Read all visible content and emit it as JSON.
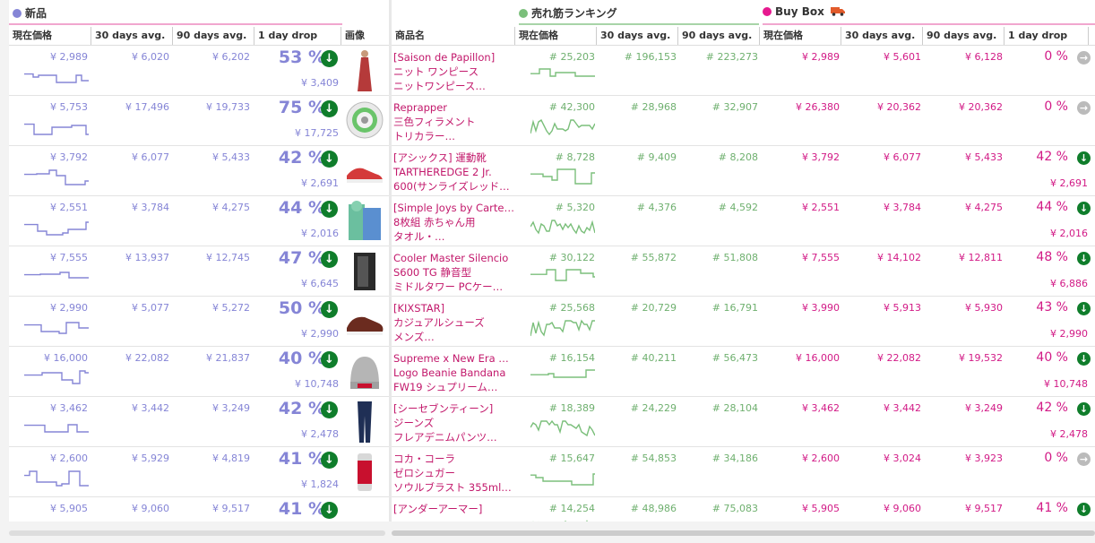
{
  "left": {
    "group_label": "新品",
    "headers": [
      "現在価格",
      "30 days avg.",
      "90 days avg.",
      "1 day drop",
      "画像"
    ]
  },
  "right": {
    "headers": [
      "商品名",
      "現在価格",
      "30 days avg.",
      "90 days avg.",
      "現在価格",
      "30 days avg.",
      "90 days avg.",
      "1 day drop"
    ],
    "group_sales": "売れ筋ランキング",
    "group_buybox": "Buy Box",
    "truck_icon": "truck-icon"
  },
  "colors": {
    "new": "#8585d6",
    "sales": "#7bbf7b",
    "buybox": "#e6198f",
    "drop_icon": "#0f7d2b"
  },
  "rows": [
    {
      "nc": "¥ 2,989",
      "n30": "¥ 6,020",
      "n90": "¥ 6,202",
      "drop": "53 %",
      "prev": "¥ 3,409",
      "title": [
        "[Saison de Papillon]",
        "ニット ワンピース",
        "ニットワンピース…"
      ],
      "sc": "# 25,203",
      "s30": "# 196,153",
      "s90": "# 223,273",
      "bc": "¥ 2,989",
      "b30": "¥ 5,601",
      "b90": "¥ 6,128",
      "bdrop": "0 %",
      "bprev": "",
      "bd": false,
      "img": "dress"
    },
    {
      "nc": "¥ 5,753",
      "n30": "¥ 17,496",
      "n90": "¥ 19,733",
      "drop": "75 %",
      "prev": "¥ 17,725",
      "title": [
        "Reprapper",
        "三色フィラメント",
        "トリカラー…"
      ],
      "sc": "# 42,300",
      "s30": "# 28,968",
      "s90": "# 32,907",
      "bc": "¥ 26,380",
      "b30": "¥ 20,362",
      "b90": "¥ 20,362",
      "bdrop": "0 %",
      "bprev": "",
      "bd": false,
      "img": "spool"
    },
    {
      "nc": "¥ 3,792",
      "n30": "¥ 6,077",
      "n90": "¥ 5,433",
      "drop": "42 %",
      "prev": "¥ 2,691",
      "title": [
        "[アシックス] 運動靴",
        "TARTHEREDGE 2 Jr.",
        "600(サンライズレッド…"
      ],
      "sc": "# 8,728",
      "s30": "# 9,409",
      "s90": "# 8,208",
      "bc": "¥ 3,792",
      "b30": "¥ 6,077",
      "b90": "¥ 5,433",
      "bdrop": "42 %",
      "bprev": "¥ 2,691",
      "bd": true,
      "img": "shoe"
    },
    {
      "nc": "¥ 2,551",
      "n30": "¥ 3,784",
      "n90": "¥ 4,275",
      "drop": "44 %",
      "prev": "¥ 2,016",
      "title": [
        "[Simple Joys by Carter's]",
        "8枚組 赤ちゃん用",
        "タオル・…"
      ],
      "sc": "# 5,320",
      "s30": "# 4,376",
      "s90": "# 4,592",
      "bc": "¥ 2,551",
      "b30": "¥ 3,784",
      "b90": "¥ 4,275",
      "bdrop": "44 %",
      "bprev": "¥ 2,016",
      "bd": true,
      "img": "towel"
    },
    {
      "nc": "¥ 7,555",
      "n30": "¥ 13,937",
      "n90": "¥ 12,745",
      "drop": "47 %",
      "prev": "¥ 6,645",
      "title": [
        "Cooler Master Silencio",
        "S600 TG 静音型",
        "ミドルタワー PCケー…"
      ],
      "sc": "# 30,122",
      "s30": "# 55,872",
      "s90": "# 51,808",
      "bc": "¥ 7,555",
      "b30": "¥ 14,102",
      "b90": "¥ 12,811",
      "bdrop": "48 %",
      "bprev": "¥ 6,886",
      "bd": true,
      "img": "pc"
    },
    {
      "nc": "¥ 2,990",
      "n30": "¥ 5,077",
      "n90": "¥ 5,272",
      "drop": "50 %",
      "prev": "¥ 2,990",
      "title": [
        "[KIXSTAR]",
        "カジュアルシューズ",
        "メンズ…"
      ],
      "sc": "# 25,568",
      "s30": "# 20,729",
      "s90": "# 16,791",
      "bc": "¥ 3,990",
      "b30": "¥ 5,913",
      "b90": "¥ 5,930",
      "bdrop": "43 %",
      "bprev": "¥ 2,990",
      "bd": true,
      "img": "brownshoe"
    },
    {
      "nc": "¥ 16,000",
      "n30": "¥ 22,082",
      "n90": "¥ 21,837",
      "drop": "40 %",
      "prev": "¥ 10,748",
      "title": [
        "Supreme x New Era Box",
        "Logo Beanie Bandana",
        "FW19 シュプリーム…"
      ],
      "sc": "# 16,154",
      "s30": "# 40,211",
      "s90": "# 56,473",
      "bc": "¥ 16,000",
      "b30": "¥ 22,082",
      "b90": "¥ 19,532",
      "bdrop": "40 %",
      "bprev": "¥ 10,748",
      "bd": true,
      "img": "beanie"
    },
    {
      "nc": "¥ 3,462",
      "n30": "¥ 3,442",
      "n90": "¥ 3,249",
      "drop": "42 %",
      "prev": "¥ 2,478",
      "title": [
        "[シーセブンティーン]",
        "ジーンズ",
        "フレアデニムパンツ…"
      ],
      "sc": "# 18,389",
      "s30": "# 24,229",
      "s90": "# 28,104",
      "bc": "¥ 3,462",
      "b30": "¥ 3,442",
      "b90": "¥ 3,249",
      "bdrop": "42 %",
      "bprev": "¥ 2,478",
      "bd": true,
      "img": "jeans"
    },
    {
      "nc": "¥ 2,600",
      "n30": "¥ 5,929",
      "n90": "¥ 4,819",
      "drop": "41 %",
      "prev": "¥ 1,824",
      "title": [
        "コカ・コーラ",
        "ゼロシュガー",
        "ソウルブラスト 355ml…"
      ],
      "sc": "# 15,647",
      "s30": "# 54,853",
      "s90": "# 34,186",
      "bc": "¥ 2,600",
      "b30": "¥ 3,024",
      "b90": "¥ 3,923",
      "bdrop": "0 %",
      "bprev": "",
      "bd": false,
      "img": "can"
    },
    {
      "nc": "¥ 5,905",
      "n30": "¥ 9,060",
      "n90": "¥ 9,517",
      "drop": "41 %",
      "prev": "",
      "title": [
        "[アンダーアーマー]",
        "",
        ""
      ],
      "sc": "# 14,254",
      "s30": "# 48,986",
      "s90": "# 75,083",
      "bc": "¥ 5,905",
      "b30": "¥ 9,060",
      "b90": "¥ 9,517",
      "bdrop": "41 %",
      "bprev": "",
      "bd": true,
      "img": "black"
    }
  ]
}
